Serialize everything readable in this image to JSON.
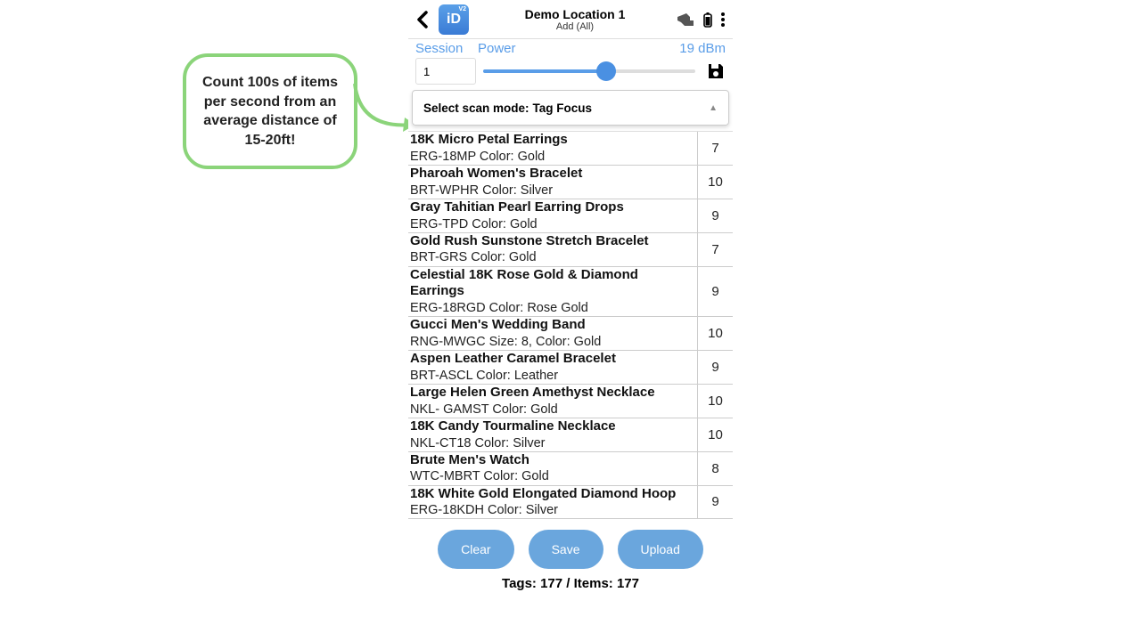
{
  "header": {
    "title": "Demo Location 1",
    "subtitle": "Add (All)"
  },
  "controls": {
    "session_label": "Session",
    "power_label": "Power",
    "power_value": "19 dBm",
    "session_value": "1"
  },
  "dropdown": {
    "label": "Select scan mode:",
    "value": "Tag Focus"
  },
  "items": [
    {
      "name": "18K Micro Petal Earrings",
      "sub": "ERG-18MP Color: Gold",
      "count": "7"
    },
    {
      "name": "Pharoah Women's Bracelet",
      "sub": "BRT-WPHR Color: Silver",
      "count": "10"
    },
    {
      "name": "Gray Tahitian Pearl Earring Drops",
      "sub": "ERG-TPD Color: Gold",
      "count": "9"
    },
    {
      "name": "Gold Rush Sunstone Stretch Bracelet",
      "sub": "BRT-GRS Color: Gold",
      "count": "7"
    },
    {
      "name": "Celestial 18K Rose Gold & Diamond Earrings",
      "sub": "ERG-18RGD Color: Rose Gold",
      "count": "9"
    },
    {
      "name": "Gucci Men's Wedding Band",
      "sub": "RNG-MWGC Size: 8, Color: Gold",
      "count": "10"
    },
    {
      "name": "Aspen Leather Caramel Bracelet",
      "sub": "BRT-ASCL Color: Leather",
      "count": "9"
    },
    {
      "name": "Large Helen Green Amethyst Necklace",
      "sub": "NKL- GAMST Color: Gold",
      "count": "10"
    },
    {
      "name": "18K Candy Tourmaline Necklace",
      "sub": "NKL-CT18 Color: Silver",
      "count": "10"
    },
    {
      "name": "Brute Men's Watch",
      "sub": "WTC-MBRT Color: Gold",
      "count": "8"
    },
    {
      "name": "18K White Gold Elongated Diamond Hoop",
      "sub": "ERG-18KDH Color: Silver",
      "count": "9"
    }
  ],
  "buttons": {
    "clear": "Clear",
    "save": "Save",
    "upload": "Upload"
  },
  "footer": "Tags: 177 / Items: 177",
  "callout": "Count 100s of items per second from an average distance of 15-20ft!"
}
